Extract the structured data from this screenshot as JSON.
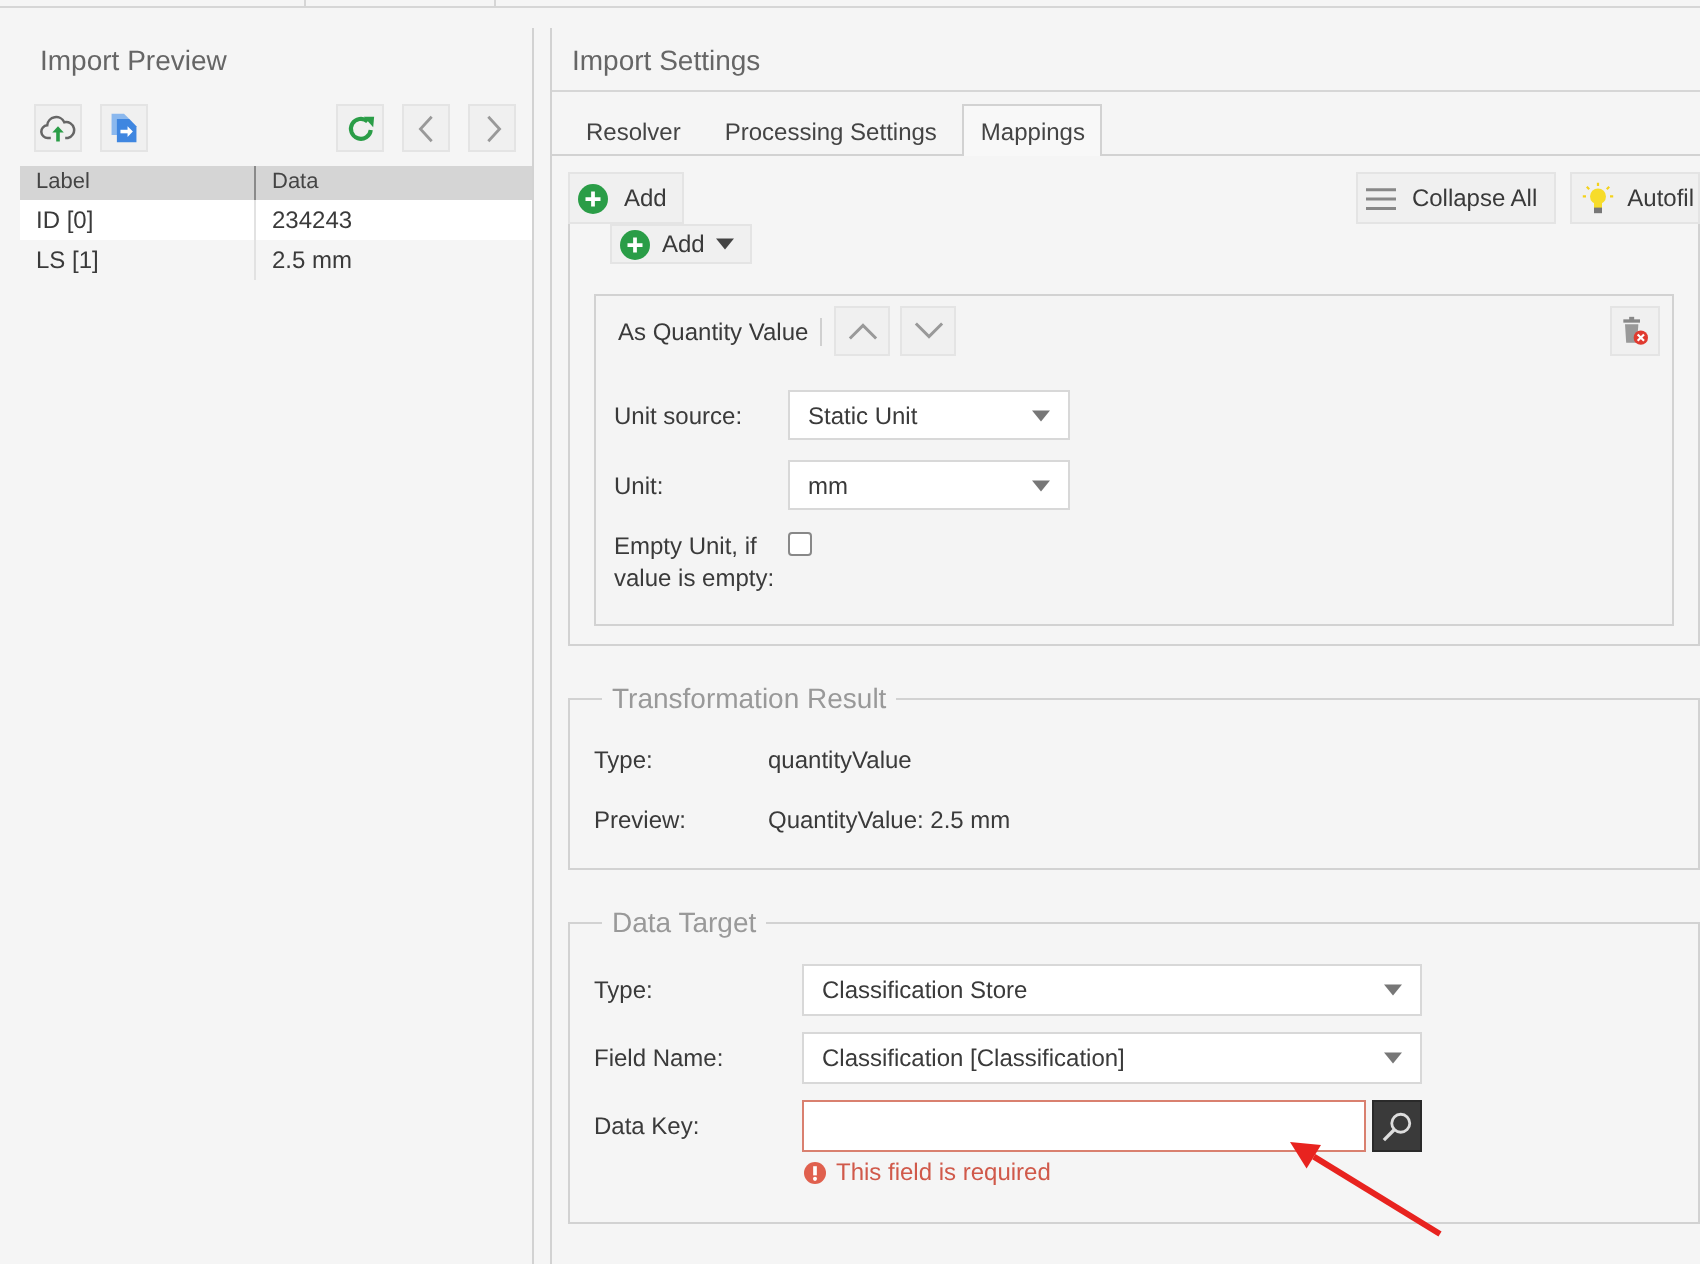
{
  "import_preview": {
    "title": "Import Preview",
    "table": {
      "columns": [
        "Label",
        "Data"
      ],
      "rows": [
        [
          "ID [0]",
          "234243"
        ],
        [
          "LS [1]",
          "2.5 mm"
        ]
      ]
    }
  },
  "import_settings": {
    "title": "Import Settings",
    "tabs": [
      {
        "label": "Resolver",
        "selected": false
      },
      {
        "label": "Processing Settings",
        "selected": false
      },
      {
        "label": "Mappings",
        "selected": true
      }
    ],
    "toolbar": {
      "add": "Add",
      "collapse_all": "Collapse All",
      "autofill": "Autofil"
    },
    "mapping": {
      "add_button": "Add",
      "operator": {
        "title": "As Quantity Value",
        "fields": [
          {
            "kind": "select",
            "label": "Unit source:",
            "value": "Static Unit"
          },
          {
            "kind": "select",
            "label": "Unit:",
            "value": "mm"
          },
          {
            "kind": "checkbox",
            "label": "Empty Unit, if value is empty:",
            "checked": false
          }
        ]
      }
    },
    "transformation_result": {
      "legend": "Transformation Result",
      "rows": [
        {
          "label": "Type:",
          "value": "quantityValue"
        },
        {
          "label": "Preview:",
          "value": "QuantityValue: 2.5 mm"
        }
      ]
    },
    "data_target": {
      "legend": "Data Target",
      "fields": [
        {
          "kind": "select",
          "label": "Type:",
          "value": "Classification Store"
        },
        {
          "kind": "select",
          "label": "Field Name:",
          "value": "Classification [Classification]"
        },
        {
          "kind": "search",
          "label": "Data Key:",
          "invalid": true,
          "error": "This field is required"
        }
      ]
    }
  }
}
